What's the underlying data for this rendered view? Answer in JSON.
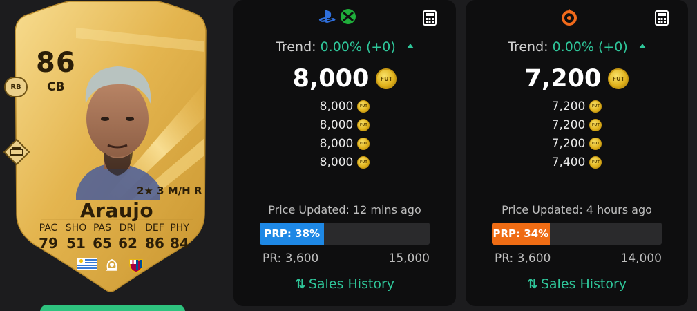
{
  "card": {
    "rating": "86",
    "position": "CB",
    "alt_position": "RB",
    "skills": "2★ 3 M/H R",
    "name": "Araujo",
    "stats": [
      {
        "label": "PAC",
        "value": "79"
      },
      {
        "label": "SHO",
        "value": "51"
      },
      {
        "label": "PAS",
        "value": "65"
      },
      {
        "label": "DRI",
        "value": "62"
      },
      {
        "label": "DEF",
        "value": "86"
      },
      {
        "label": "PHY",
        "value": "84"
      }
    ],
    "icons": {
      "playstyle": "playstyle-icon",
      "nation": "uruguay-flag-icon",
      "league": "laliga-logo-icon",
      "club": "barcelona-crest-icon"
    },
    "colors": {
      "gold": "#e7bd57",
      "dark_text": "#2b1e08"
    }
  },
  "panels": [
    {
      "platforms": [
        "playstation-icon",
        "xbox-icon"
      ],
      "trend_label": "Trend:",
      "trend_value": "0.00% (+0)",
      "main_price": "8,000",
      "coin_label": "FUT",
      "prices": [
        "8,000",
        "8,000",
        "8,000",
        "8,000"
      ],
      "updated": "Price Updated: 12 mins ago",
      "prp_label": "PRP: 38%",
      "prp_percent": 38,
      "prp_color": "#1e88e5",
      "pr_min": "PR: 3,600",
      "pr_max": "15,000",
      "sales_label": "Sales History"
    },
    {
      "platforms": [
        "origin-icon"
      ],
      "trend_label": "Trend:",
      "trend_value": "0.00% (+0)",
      "main_price": "7,200",
      "coin_label": "FUT",
      "prices": [
        "7,200",
        "7,200",
        "7,200",
        "7,400"
      ],
      "updated": "Price Updated: 4 hours ago",
      "prp_label": "PRP: 34%",
      "prp_percent": 34,
      "prp_color": "#ef6c14",
      "pr_min": "PR: 3,600",
      "pr_max": "14,000",
      "sales_label": "Sales History"
    }
  ],
  "accent": "#2fc69a"
}
